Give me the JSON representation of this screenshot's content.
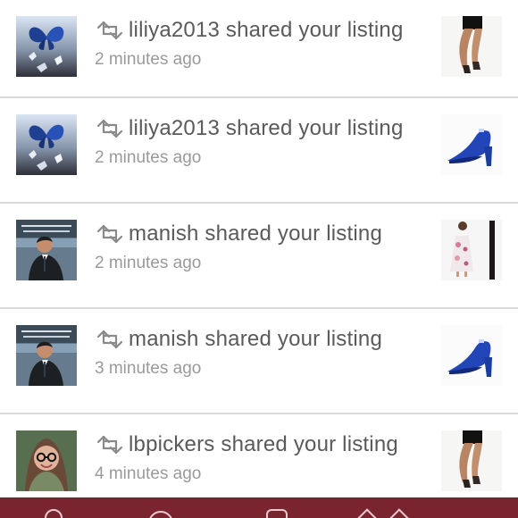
{
  "feed": {
    "items": [
      {
        "user": "liliya2013",
        "message": "liliya2013 shared your listing",
        "time": "2 minutes ago",
        "avatar_icon": "butterfly-avatar-icon",
        "listing_icon": "legs-heels-listing-icon"
      },
      {
        "user": "liliya2013",
        "message": "liliya2013 shared your listing",
        "time": "2 minutes ago",
        "avatar_icon": "butterfly-avatar-icon",
        "listing_icon": "blue-pump-listing-icon"
      },
      {
        "user": "manish",
        "message": "manish shared your listing",
        "time": "2 minutes ago",
        "avatar_icon": "man-portrait-avatar-icon",
        "listing_icon": "floral-dress-listing-icon"
      },
      {
        "user": "manish",
        "message": "manish shared your listing",
        "time": "3 minutes ago",
        "avatar_icon": "man-portrait-avatar-icon",
        "listing_icon": "blue-pump-listing-icon"
      },
      {
        "user": "lbpickers",
        "message": "lbpickers shared your listing",
        "time": "4 minutes ago",
        "avatar_icon": "woman-portrait-avatar-icon",
        "listing_icon": "legs-heels-listing-icon"
      }
    ]
  },
  "colors": {
    "text": "#5a5a5a",
    "timestamp": "#9a9a9a",
    "divider": "#d9d9d9",
    "bottom_bar": "#7a2430"
  }
}
